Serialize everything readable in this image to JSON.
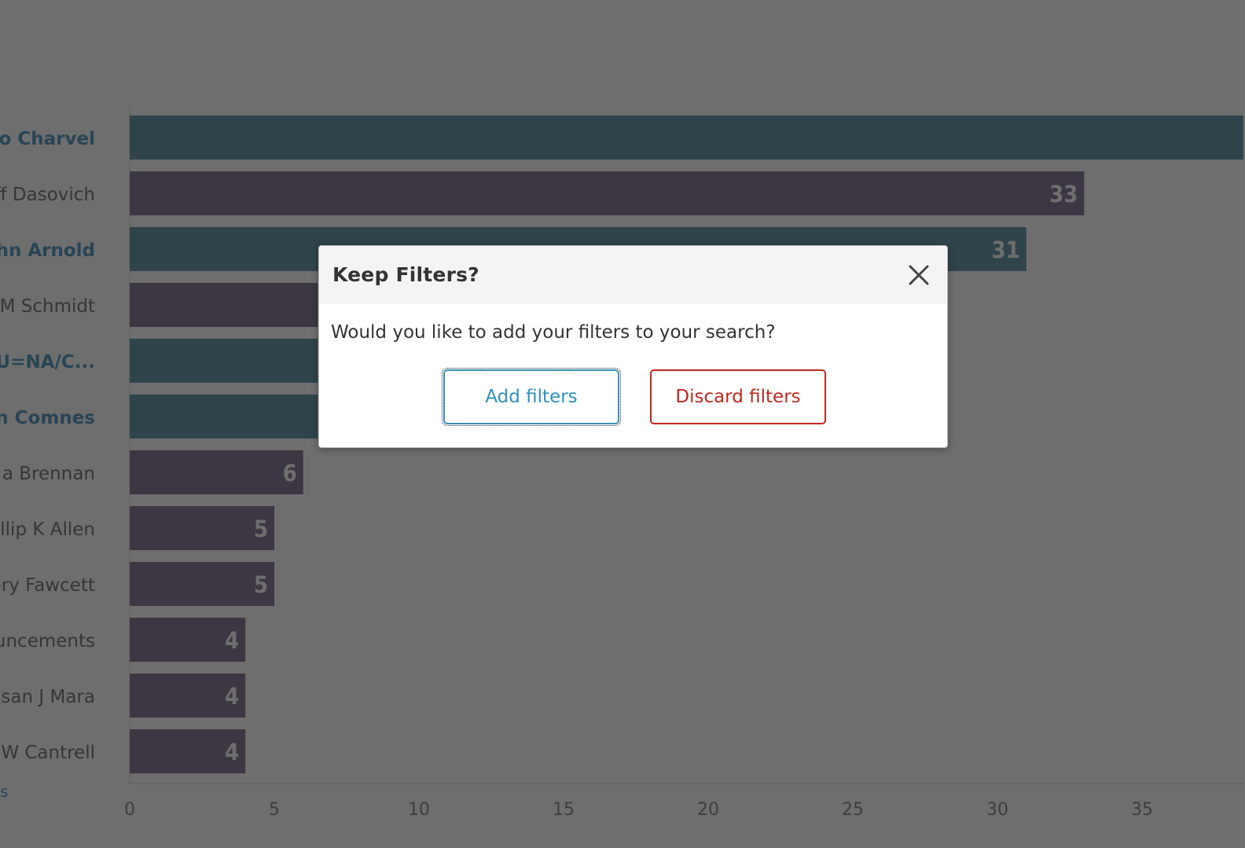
{
  "chart_data": {
    "type": "bar",
    "orientation": "horizontal",
    "categories": [
      "do Charvel",
      "ff Dasovich",
      "ohn Arnold",
      "M Schmidt",
      "OU=NA/C...",
      "n Comnes",
      "a Brennan",
      "llip K Allen",
      "ery Fawcett",
      "uncements",
      "isan J Mara",
      "W Cantrell"
    ],
    "values": [
      38.5,
      33,
      31,
      6.5,
      6.5,
      6.5,
      6,
      5,
      5,
      4,
      4,
      4
    ],
    "value_labels": [
      "",
      "33",
      "31",
      "",
      "",
      "",
      "6",
      "5",
      "5",
      "4",
      "4",
      "4"
    ],
    "highlighted": [
      true,
      false,
      true,
      false,
      true,
      true,
      false,
      false,
      false,
      false,
      false,
      false
    ],
    "x_ticks": [
      "0",
      "5",
      "10",
      "15",
      "20",
      "25",
      "30",
      "35"
    ],
    "xlim": [
      0,
      38.5
    ],
    "truncated_footer_label": "s",
    "colors": {
      "highlight_bar": "#6f9fb1",
      "normal_bar": "#8d7f9c",
      "highlight_label": "#5fa0c7",
      "normal_label": "#7e7e7e",
      "value_label": "#ffffff",
      "tick_label": "#8f8f8f",
      "axis_line": "#e6e6e6"
    }
  },
  "overlay": {
    "color": "rgba(0,0,0,0.57)"
  },
  "modal": {
    "title": "Keep Filters?",
    "message": "Would you like to add your filters to your search?",
    "close_icon": "close-icon",
    "add_button_label": "Add filters",
    "discard_button_label": "Discard filters",
    "colors": {
      "add": "#2f8fbf",
      "discard": "#c0271f"
    }
  }
}
